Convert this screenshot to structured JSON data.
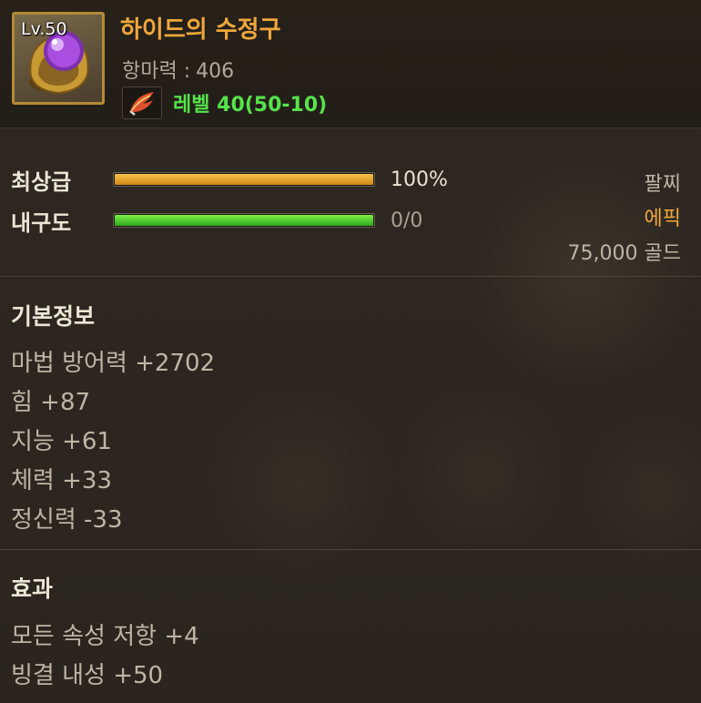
{
  "item": {
    "level_badge": "Lv.50",
    "name": "하이드의 수정구",
    "defense_label": "항마력 :",
    "defense_value": "406",
    "requirement_text": "레벨 40(50-10)",
    "icon": "purple-orb-ring-icon",
    "requirement_icon": "feather-quill-icon"
  },
  "bars": [
    {
      "label": "최상급",
      "value_text": "100%",
      "fill_fraction": 1.0,
      "color": "#e3a02a"
    },
    {
      "label": "내구도",
      "value_text": "0/0",
      "fill_fraction": 1.0,
      "color": "#4ccb2a"
    }
  ],
  "side_info": {
    "slot": "팔찌",
    "rarity": "에픽",
    "price": "75,000 골드"
  },
  "basic_info": {
    "title": "기본정보",
    "stats": [
      "마법 방어력 +2702",
      "힘 +87",
      "지능 +61",
      "체력 +33",
      "정신력 -33"
    ]
  },
  "effects": {
    "title": "효과",
    "lines": [
      "모든 속성 저항 +4",
      "빙결 내성 +50"
    ]
  },
  "colors": {
    "item_name": "#f0a83c",
    "requirement": "#56e34a",
    "rarity_epic": "#f0a83c"
  }
}
